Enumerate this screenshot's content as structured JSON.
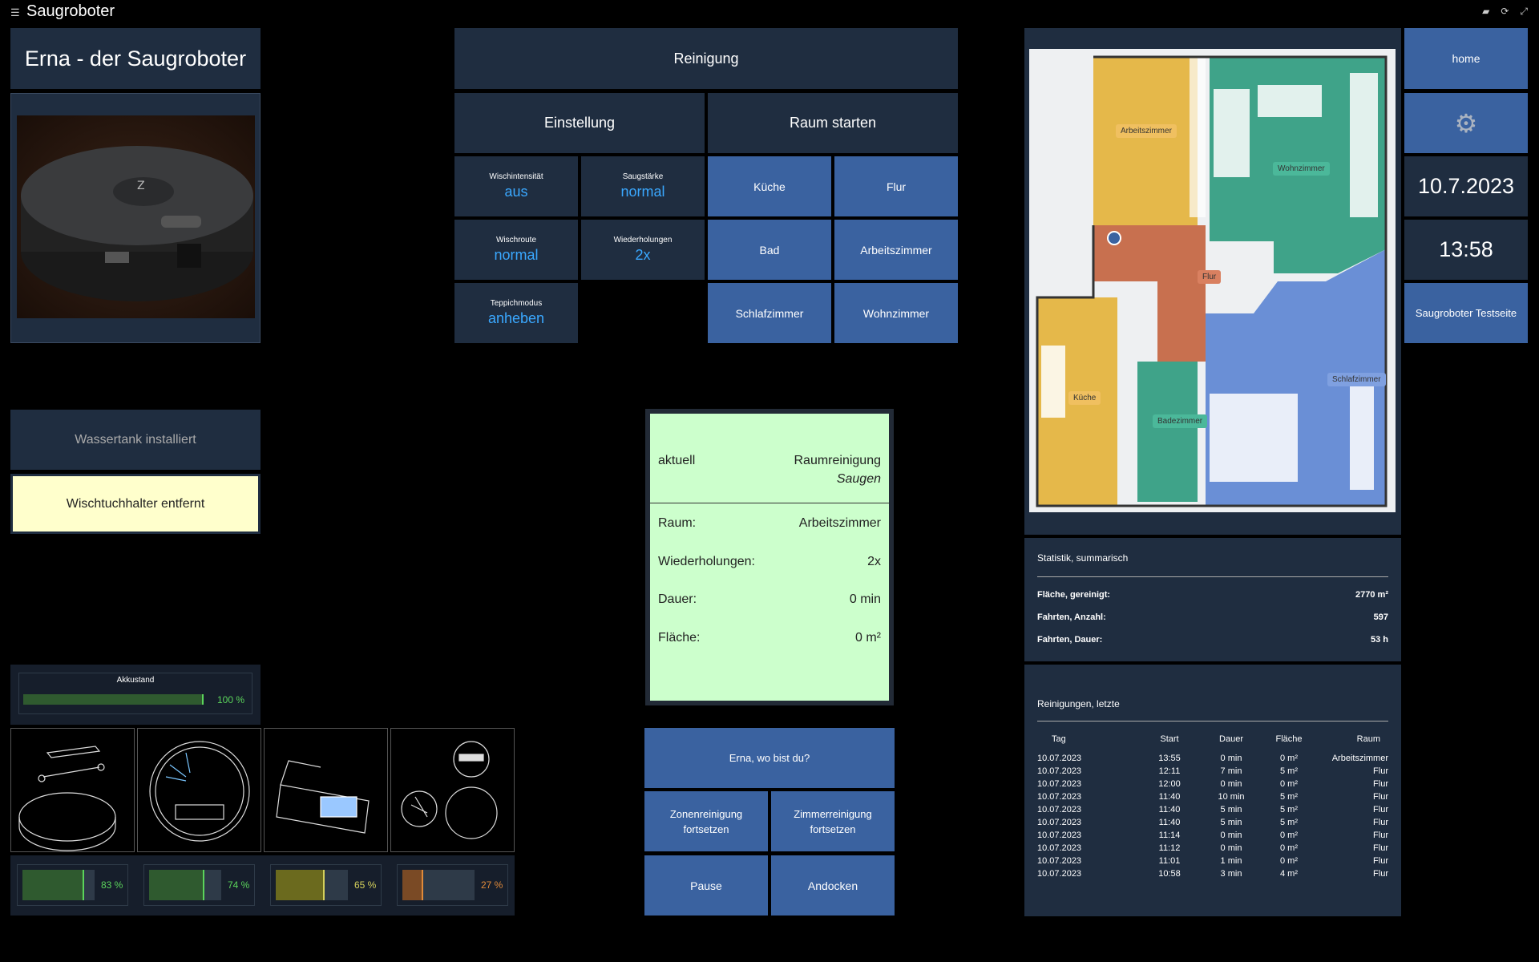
{
  "app": {
    "title": "Saugroboter"
  },
  "robot": {
    "name": "Erna - der Saugroboter"
  },
  "notices": {
    "tank": "Wassertank installiert",
    "mop": "Wischtuchhalter entfernt"
  },
  "battery": {
    "label": "Akkustand",
    "value": 100,
    "text": "100 %"
  },
  "consumables": [
    {
      "name": "main-brush",
      "value": 83,
      "text": "83 %",
      "color": "#2f5a2f",
      "text_color": "#5bd45b"
    },
    {
      "name": "side-brush",
      "value": 74,
      "text": "74 %",
      "color": "#2f5a2f",
      "text_color": "#5bd45b"
    },
    {
      "name": "filter",
      "value": 65,
      "text": "65 %",
      "color": "#6b6a1e",
      "text_color": "#d4d05b"
    },
    {
      "name": "sensors",
      "value": 27,
      "text": "27 %",
      "color": "#7a4a25",
      "text_color": "#e08a3a"
    }
  ],
  "cleaning": {
    "header": "Reinigung",
    "settings_header": "Einstellung",
    "rooms_header": "Raum starten",
    "settings": [
      {
        "label": "Wischintensität",
        "value": "aus"
      },
      {
        "label": "Saugstärke",
        "value": "normal"
      },
      {
        "label": "Wischroute",
        "value": "normal"
      },
      {
        "label": "Wiederholungen",
        "value": "2x"
      },
      {
        "label": "Teppichmodus",
        "value": "anheben"
      }
    ],
    "rooms": [
      "Küche",
      "Flur",
      "Bad",
      "Arbeitszimmer",
      "Schlafzimmer",
      "Wohnzimmer"
    ]
  },
  "status": {
    "current_label": "aktuell",
    "mode": "Raumreinigung",
    "submode": "Saugen",
    "rows": [
      {
        "label": "Raum:",
        "value": "Arbeitszimmer"
      },
      {
        "label": "Wiederholungen:",
        "value": "2x"
      },
      {
        "label": "Dauer:",
        "value": "0 min"
      },
      {
        "label": "Fläche:",
        "value": "0 m²"
      }
    ]
  },
  "actions": {
    "locate": "Erna, wo bist du?",
    "zone_resume": "Zonenreinigung fortsetzen",
    "room_resume": "Zimmerreinigung fortsetzen",
    "pause": "Pause",
    "dock": "Andocken"
  },
  "map": {
    "labels": [
      "Arbeitszimmer",
      "Wohnzimmer",
      "Flur",
      "Küche",
      "Badezimmer",
      "Schlafzimmer"
    ],
    "colors": {
      "arbeitszimmer": "#e5b84a",
      "wohnzimmer": "#3fa389",
      "flur": "#c8704f",
      "kueche": "#e5b84a",
      "bad": "#3fa389",
      "schlafzimmer": "#6a8fd6"
    }
  },
  "nav": {
    "home": "home",
    "date": "10.7.2023",
    "time": "13:58",
    "testpage": "Saugroboter Testseite"
  },
  "stats": {
    "header": "Statistik, summarisch",
    "rows": [
      {
        "label": "Fläche, gereinigt:",
        "value": "2770 m²"
      },
      {
        "label": "Fahrten, Anzahl:",
        "value": "597"
      },
      {
        "label": "Fahrten, Dauer:",
        "value": "53 h"
      }
    ]
  },
  "history": {
    "header": "Reinigungen, letzte",
    "columns": [
      "Tag",
      "Start",
      "Dauer",
      "Fläche",
      "Raum"
    ],
    "rows": [
      [
        "10.07.2023",
        "13:55",
        "0 min",
        "0 m²",
        "Arbeitszimmer"
      ],
      [
        "10.07.2023",
        "12:11",
        "7 min",
        "5 m²",
        "Flur"
      ],
      [
        "10.07.2023",
        "12:00",
        "0 min",
        "0 m²",
        "Flur"
      ],
      [
        "10.07.2023",
        "11:40",
        "10 min",
        "5 m²",
        "Flur"
      ],
      [
        "10.07.2023",
        "11:40",
        "5 min",
        "5 m²",
        "Flur"
      ],
      [
        "10.07.2023",
        "11:40",
        "5 min",
        "5 m²",
        "Flur"
      ],
      [
        "10.07.2023",
        "11:14",
        "0 min",
        "0 m²",
        "Flur"
      ],
      [
        "10.07.2023",
        "11:12",
        "0 min",
        "0 m²",
        "Flur"
      ],
      [
        "10.07.2023",
        "11:01",
        "1 min",
        "0 m²",
        "Flur"
      ],
      [
        "10.07.2023",
        "10:58",
        "3 min",
        "4 m²",
        "Flur"
      ]
    ]
  }
}
